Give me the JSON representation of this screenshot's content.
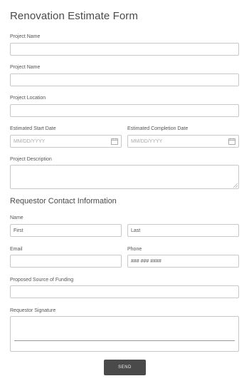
{
  "form": {
    "title": "Renovation Estimate Form",
    "fields": {
      "project_name_1": {
        "label": "Project Name",
        "value": ""
      },
      "project_name_2": {
        "label": "Project Name",
        "value": ""
      },
      "project_location": {
        "label": "Project Location",
        "value": ""
      },
      "start_date": {
        "label": "Estimated Start Date",
        "placeholder": "MM/DD/YYYY"
      },
      "completion_date": {
        "label": "Estimated Completion Date",
        "placeholder": "MM/DD/YYYY"
      },
      "project_description": {
        "label": "Project Description",
        "value": ""
      }
    },
    "section_title": "Requestor Contact Information",
    "contact": {
      "name_label": "Name",
      "first_value": "First",
      "last_value": "Last",
      "email_label": "Email",
      "email_value": "",
      "phone_label": "Phone",
      "phone_value": "### ### ####",
      "funding_label": "Proposed Source of Funding",
      "funding_value": "",
      "signature_label": "Requestor Signature"
    },
    "submit_label": "SEND"
  },
  "icons": {
    "date_picker": "calendar-icon",
    "resize": "resize-grip-icon"
  },
  "colors": {
    "button_bg": "#4a4a4a",
    "border": "#c8c8c8",
    "text": "#4a4a4a"
  }
}
